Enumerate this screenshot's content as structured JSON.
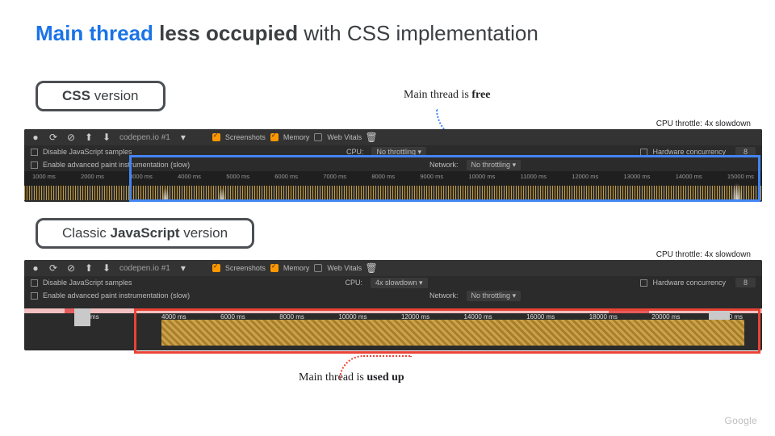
{
  "title": {
    "part1": "Main thread",
    "part2": "less occupied",
    "part3": "with CSS implementation"
  },
  "pill1": {
    "bold": "CSS",
    "rest": " version"
  },
  "pill2": {
    "pre": "Classic ",
    "bold": "JavaScript",
    "rest": " version"
  },
  "throttle_label": "CPU throttle: 4x slowdown",
  "annotation1": {
    "pre": "Main thread is ",
    "bold": "free"
  },
  "annotation2": {
    "pre": "Main thread is ",
    "bold": "used up"
  },
  "toolbar": {
    "tab": "codepen.io #1",
    "screenshots": "Screenshots",
    "memory": "Memory",
    "webvitals": "Web Vitals"
  },
  "rows": {
    "disable_js": "Disable JavaScript samples",
    "cpu_label": "CPU:",
    "cpu_val1": "No throttling",
    "cpu_val2": "4x slowdown",
    "hw": "Hardware concurrency",
    "hw_val": "8",
    "adv_paint": "Enable advanced paint instrumentation (slow)",
    "net_label": "Network:",
    "net_val": "No throttling"
  },
  "ticks1": [
    "1000 ms",
    "2000 ms",
    "3000 ms",
    "4000 ms",
    "5000 ms",
    "6000 ms",
    "7000 ms",
    "8000 ms",
    "9000 ms",
    "10000 ms",
    "11000 ms",
    "12000 ms",
    "13000 ms",
    "14000 ms",
    "15000 ms"
  ],
  "ticks2": [
    "4000 ms",
    "6000 ms",
    "8000 ms",
    "10000 ms",
    "12000 ms",
    "14000 ms",
    "16000 ms",
    "18000 ms",
    "20000 ms",
    "22000 ms"
  ],
  "tick2_first": "2000 ms",
  "footer": "Google",
  "dropdown_glyph": "▾"
}
